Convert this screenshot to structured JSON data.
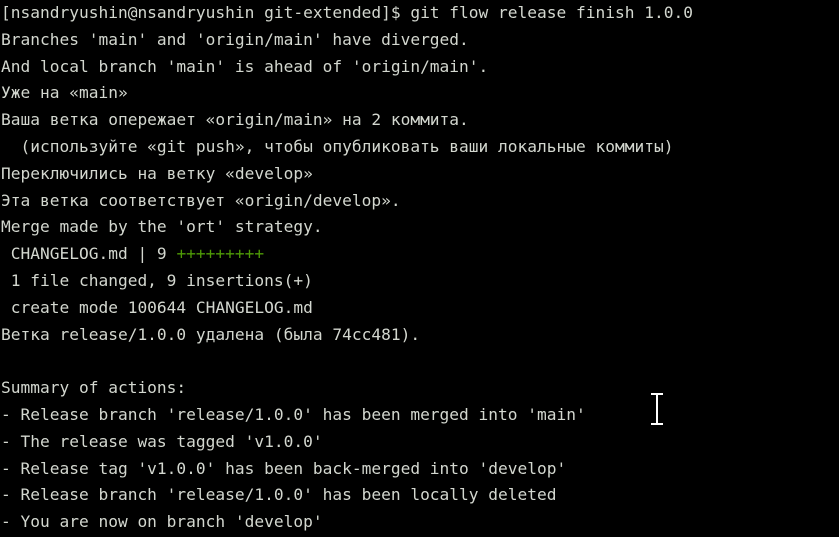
{
  "terminal": {
    "lines": [
      "[nsandryushin@nsandryushin git-extended]$ git flow release finish 1.0.0",
      "Branches 'main' and 'origin/main' have diverged.",
      "And local branch 'main' is ahead of 'origin/main'.",
      "Уже на «main»",
      "Ваша ветка опережает «origin/main» на 2 коммита.",
      "  (используйте «git push», чтобы опубликовать ваши локальные коммиты)",
      "Переключились на ветку «develop»",
      "Эта ветка соответствует «origin/develop».",
      "Merge made by the 'ort' strategy.",
      " CHANGELOG.md | 9 ",
      " 1 file changed, 9 insertions(+)",
      " create mode 100644 CHANGELOG.md",
      "Ветка release/1.0.0 удалена (была 74cc481).",
      "",
      "Summary of actions:",
      "- Release branch 'release/1.0.0' has been merged into 'main'",
      "- The release was tagged 'v1.0.0'",
      "- Release tag 'v1.0.0' has been back-merged into 'develop'",
      "- Release branch 'release/1.0.0' has been locally deleted",
      "- You are now on branch 'develop'"
    ],
    "diffstat_plus": "+++++++++",
    "colors": {
      "background": "#000000",
      "foreground": "#d3d7cf",
      "insertions": "#4e9a06"
    }
  },
  "cursor": {
    "icon": "text-ibeam-cursor"
  }
}
